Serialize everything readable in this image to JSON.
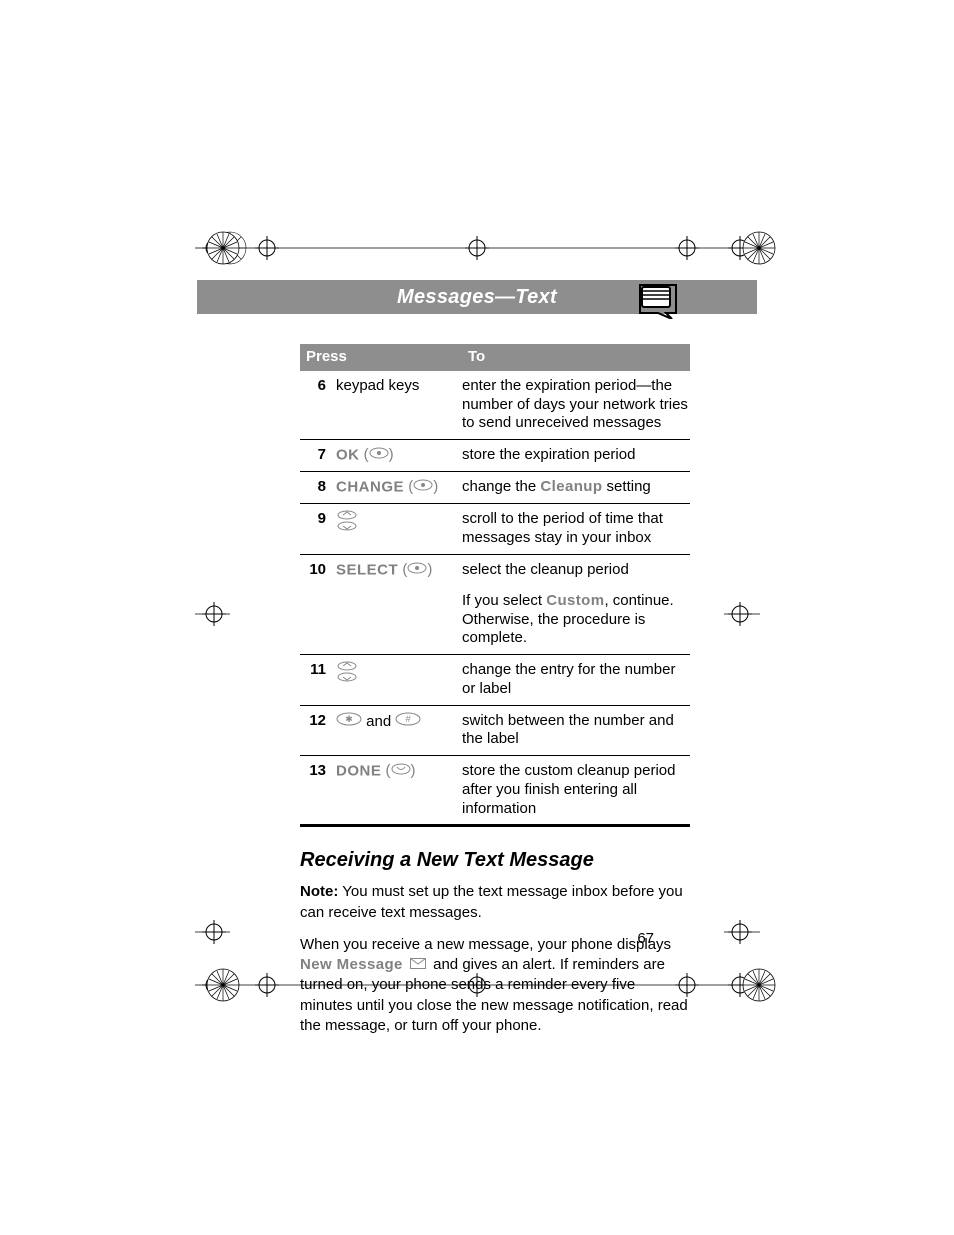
{
  "header": {
    "title": "Messages—Text"
  },
  "table": {
    "headers": {
      "press": "Press",
      "to": "To"
    },
    "rows": [
      {
        "num": "6",
        "press_plain": "keypad keys",
        "desc": "enter the expiration period—the number of days your network tries to send unreceived messages"
      },
      {
        "num": "7",
        "softkey": "OK",
        "paren_icon": "ok",
        "desc": "store the expiration period"
      },
      {
        "num": "8",
        "softkey": "CHANGE",
        "paren_icon": "ok",
        "desc_pre": "change the ",
        "desc_screen": "Cleanup",
        "desc_post": " setting"
      },
      {
        "num": "9",
        "icon": "scroll",
        "desc": "scroll to the period of time that messages stay in your inbox"
      },
      {
        "num": "10",
        "softkey": "SELECT",
        "paren_icon": "ok",
        "desc": "select the cleanup period",
        "desc2_pre": "If you select ",
        "desc2_screen": "Custom",
        "desc2_post": ", continue. Otherwise, the procedure is complete."
      },
      {
        "num": "11",
        "icon": "scroll",
        "desc": "change the entry for the number or label"
      },
      {
        "num": "12",
        "left_icon": "star",
        "join": " and ",
        "right_icon": "hash",
        "desc": "switch between the number and the label"
      },
      {
        "num": "13",
        "softkey": "DONE",
        "paren_icon": "done",
        "desc": "store the custom cleanup period after you finish entering all information"
      }
    ]
  },
  "section": {
    "title": "Receiving a New Text Message",
    "note_label": "Note:",
    "note_body": " You must set up the text message inbox before you can receive text messages.",
    "para_pre": "When you receive a new message, your phone displays ",
    "para_screen": "New Message",
    "para_post": " and gives an alert. If reminders are turned on, your phone sends a reminder every five minutes until you close the new message notification, read the message, or turn off your phone."
  },
  "page_number": "67"
}
